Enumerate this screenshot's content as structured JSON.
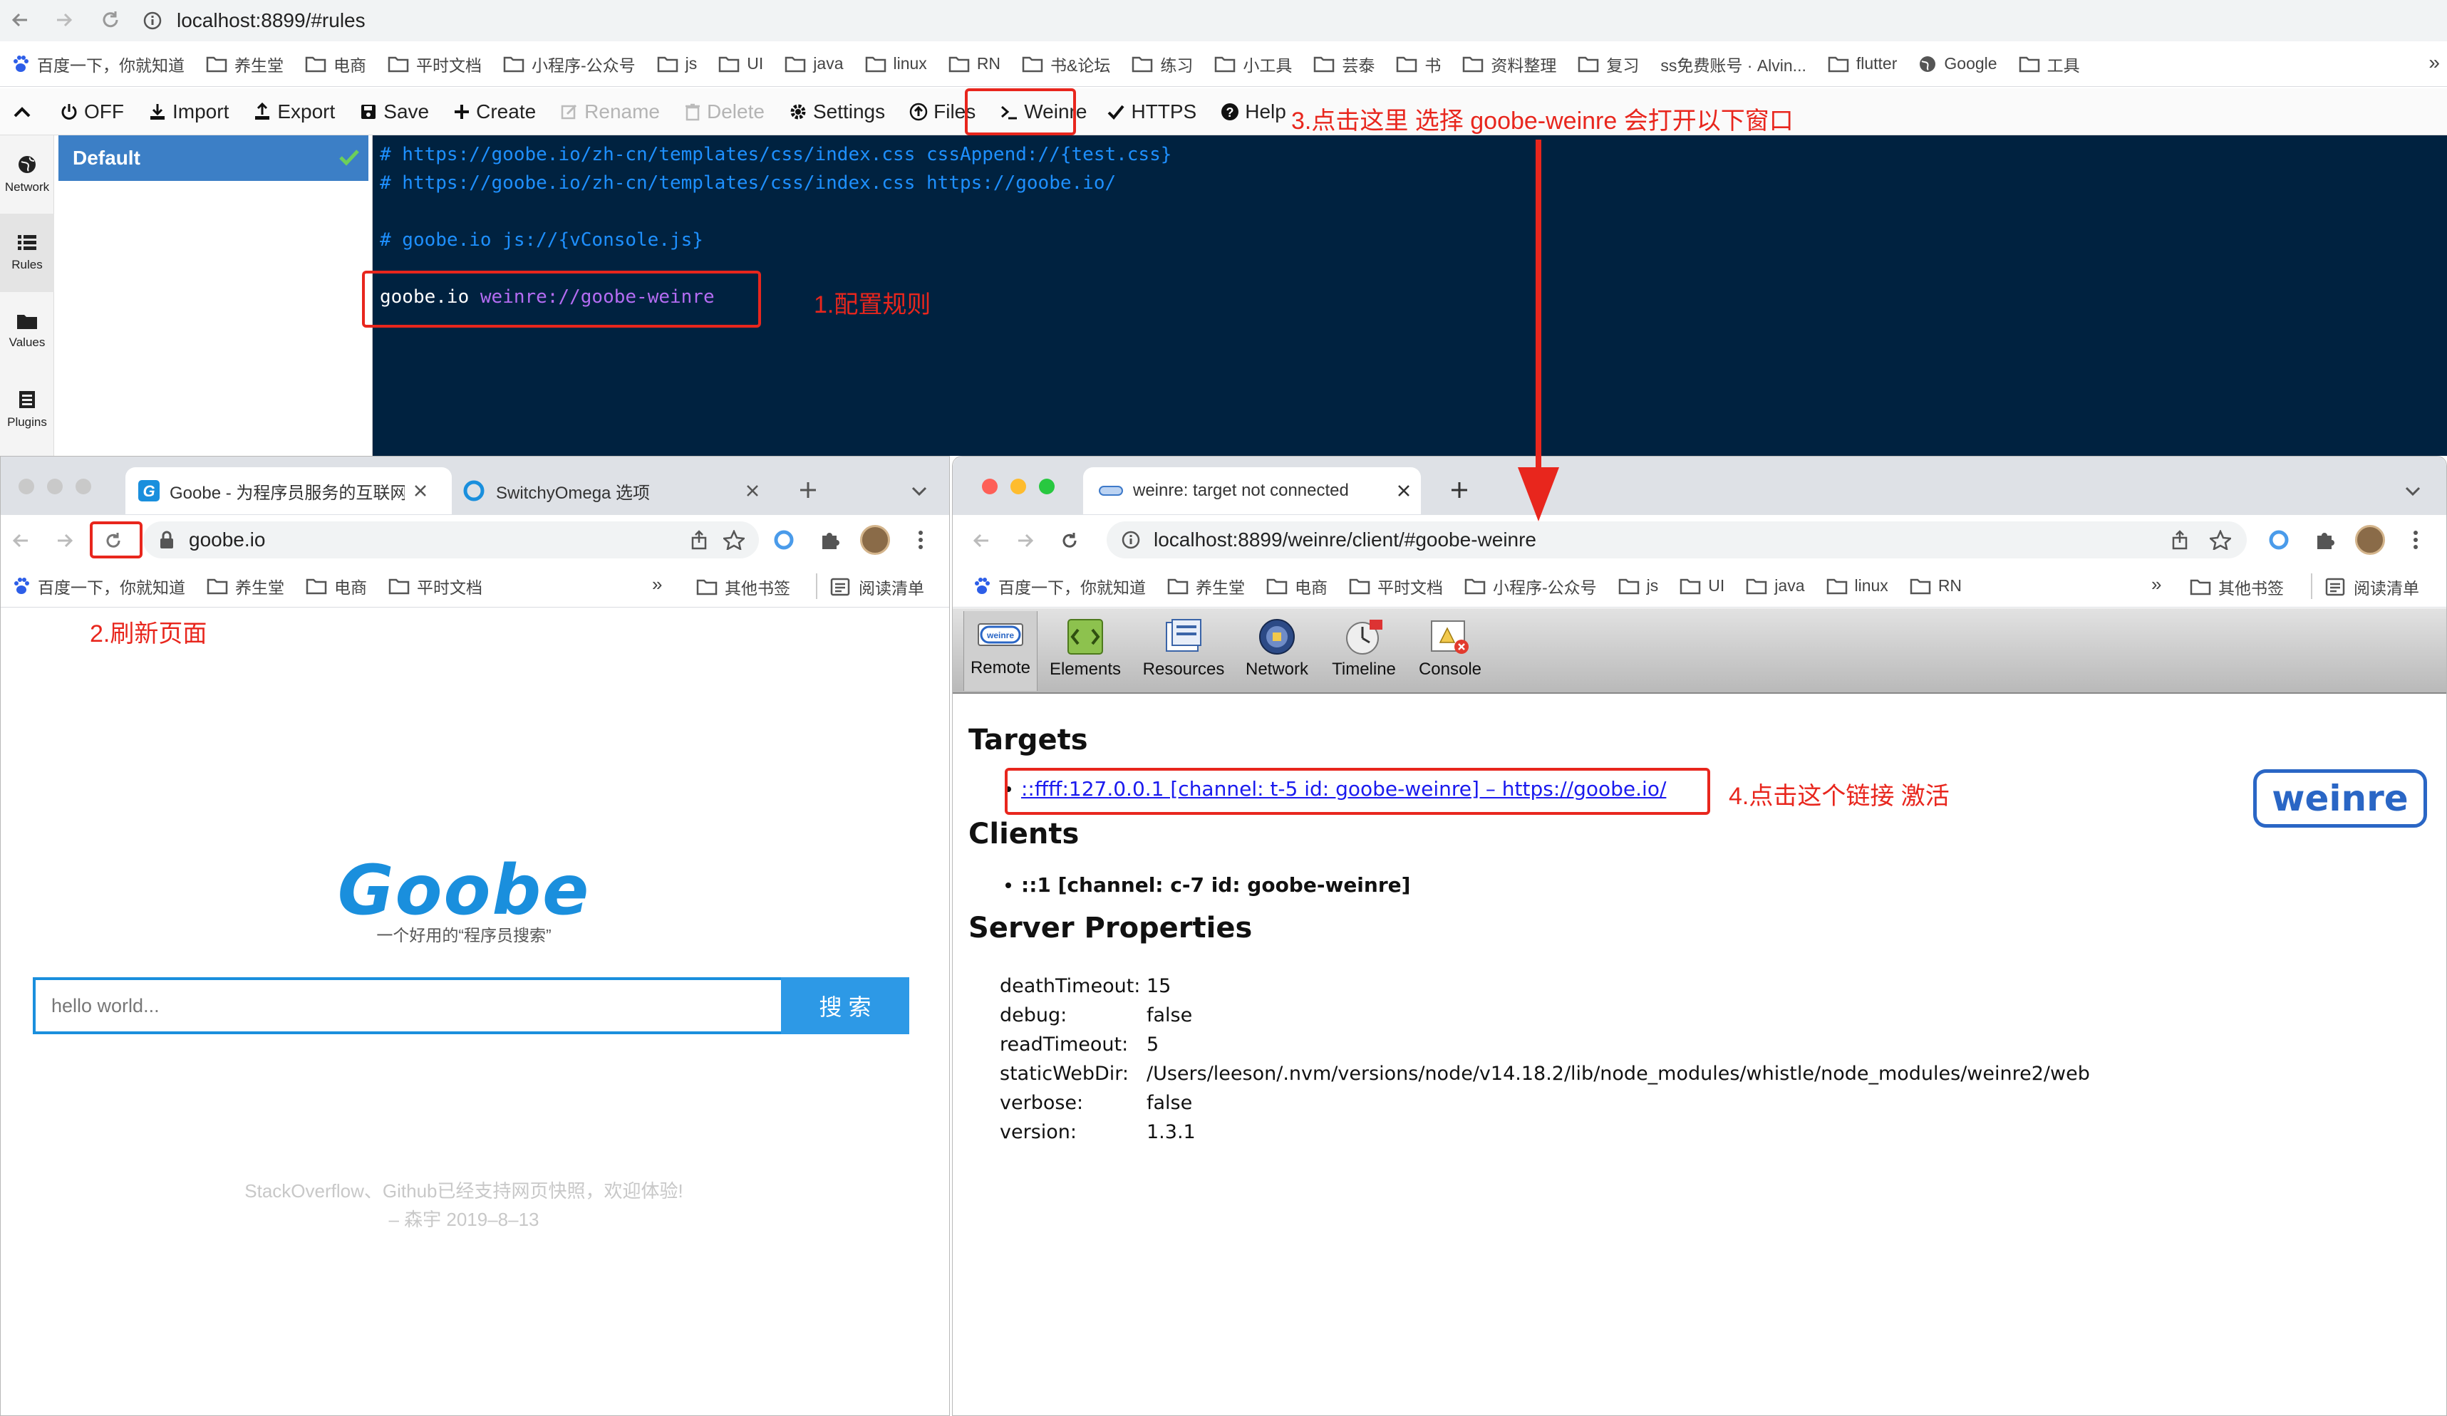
{
  "top_browser": {
    "url": "localhost:8899/#rules",
    "bookmarks": [
      "百度一下，你就知道",
      "养生堂",
      "电商",
      "平时文档",
      "小程序-公众号",
      "js",
      "UI",
      "java",
      "linux",
      "RN",
      "书&论坛",
      "练习",
      "小工具",
      "芸泰",
      "书",
      "资料整理",
      "复习",
      "ss免费账号 · Alvin...",
      "flutter",
      "Google",
      "工具"
    ],
    "more": "»"
  },
  "whistle": {
    "toolbar": {
      "off": "OFF",
      "import": "Import",
      "export": "Export",
      "save": "Save",
      "create": "Create",
      "rename": "Rename",
      "delete": "Delete",
      "settings": "Settings",
      "files": "Files",
      "weinre": "Weinre",
      "https": "HTTPS",
      "help": "Help"
    },
    "sidebar": [
      {
        "label": "Network",
        "icon": "globe-icon"
      },
      {
        "label": "Rules",
        "icon": "list-icon"
      },
      {
        "label": "Values",
        "icon": "folder-icon"
      },
      {
        "label": "Plugins",
        "icon": "plugin-icon"
      }
    ],
    "rules_list": {
      "item": "Default"
    },
    "editor": {
      "line1": "# https://goobe.io/zh-cn/templates/css/index.css cssAppend://{test.css}",
      "line2": "# https://goobe.io/zh-cn/templates/css/index.css https://goobe.io/",
      "line3": "# goobe.io js://{vConsole.js}",
      "line4_host": "goobe.io",
      "line4_target": "weinre://goobe-weinre"
    }
  },
  "annotations": {
    "step1": "1.配置规则",
    "step2": "2.刷新页面",
    "step3": "3.点击这里 选择 goobe-weinre 会打开以下窗口",
    "step4": "4.点击这个链接 激活"
  },
  "left_browser": {
    "tabs": [
      {
        "title": "Goobe - 为程序员服务的互联网"
      },
      {
        "title": "SwitchyOmega 选项"
      }
    ],
    "url": "goobe.io",
    "bookmarks": [
      "百度一下，你就知道",
      "养生堂",
      "电商",
      "平时文档"
    ],
    "more": "»",
    "other_bookmarks": "其他书签",
    "reading_list": "阅读清单",
    "page": {
      "logo": "Goobe",
      "tagline": "一个好用的“程序员搜索”",
      "search_placeholder": "hello world...",
      "search_button": "搜 索",
      "notice": "StackOverflow、Github已经支持网页快照，欢迎体验!",
      "notice_sign": "– 森宇 2019–8–13"
    }
  },
  "right_browser": {
    "tab_title": "weinre: target not connected",
    "url": "localhost:8899/weinre/client/#goobe-weinre",
    "bookmarks": [
      "百度一下，你就知道",
      "养生堂",
      "电商",
      "平时文档",
      "小程序-公众号",
      "js",
      "UI",
      "java",
      "linux",
      "RN"
    ],
    "more": "»",
    "other_bookmarks": "其他书签",
    "reading_list": "阅读清单",
    "weinre_tabs": [
      "Remote",
      "Elements",
      "Resources",
      "Network",
      "Timeline",
      "Console"
    ],
    "remote_icon_text": "weinre",
    "logo": "weinre",
    "targets_heading": "Targets",
    "target_link": "::ffff:127.0.0.1 [channel: t-5 id: goobe-weinre] – https://goobe.io/",
    "clients_heading": "Clients",
    "client_item": "::1 [channel: c-7 id: goobe-weinre]",
    "server_heading": "Server Properties",
    "properties": [
      {
        "key": "deathTimeout:",
        "value": "15"
      },
      {
        "key": "debug:",
        "value": "false"
      },
      {
        "key": "readTimeout:",
        "value": "5"
      },
      {
        "key": "staticWebDir:",
        "value": "/Users/leeson/.nvm/versions/node/v14.18.2/lib/node_modules/whistle/node_modules/weinre2/web"
      },
      {
        "key": "verbose:",
        "value": "false"
      },
      {
        "key": "version:",
        "value": "1.3.1"
      }
    ]
  },
  "colors": {
    "editor_bg": "#002240",
    "comment": "#1e90ff",
    "weinre_protocol": "#b46cf3",
    "annotation": "#e8261d",
    "goobe_blue": "#1a8fdd"
  }
}
